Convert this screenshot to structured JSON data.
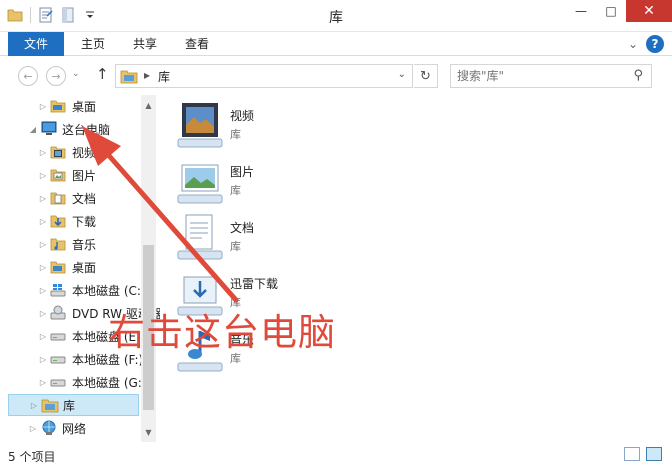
{
  "window": {
    "title": "库",
    "minimize_glyph": "—",
    "maximize_glyph": "□",
    "close_glyph": "✕"
  },
  "ribbon": {
    "tabs": [
      {
        "label": "文件"
      },
      {
        "label": "主页"
      },
      {
        "label": "共享"
      },
      {
        "label": "查看"
      }
    ],
    "collapse_glyph": "⌄",
    "help_glyph": "?"
  },
  "address": {
    "back_glyph": "←",
    "forward_glyph": "→",
    "recent_glyph": "⌄",
    "up_glyph": "↑",
    "separator_glyph": "▸",
    "crumb": "库",
    "dropdown_glyph": "⌄",
    "refresh_glyph": "↻"
  },
  "search": {
    "placeholder": "搜索\"库\"",
    "icon": "search-icon",
    "icon_glyph": "⚲"
  },
  "nav": {
    "items": [
      {
        "label": "桌面",
        "icon": "desktop-folder-icon",
        "expander": "▷"
      },
      {
        "label": "这台电脑",
        "icon": "computer-icon",
        "expander": "◢"
      },
      {
        "label": "视频",
        "icon": "video-folder-icon",
        "expander": "▷"
      },
      {
        "label": "图片",
        "icon": "pictures-folder-icon",
        "expander": "▷"
      },
      {
        "label": "文档",
        "icon": "documents-folder-icon",
        "expander": "▷"
      },
      {
        "label": "下载",
        "icon": "downloads-folder-icon",
        "expander": "▷"
      },
      {
        "label": "音乐",
        "icon": "music-folder-icon",
        "expander": "▷"
      },
      {
        "label": "桌面",
        "icon": "desktop-folder-icon",
        "expander": "▷"
      },
      {
        "label": "本地磁盘 (C:)",
        "icon": "windows-drive-icon",
        "expander": "▷"
      },
      {
        "label": "DVD RW 驱动器",
        "icon": "dvd-drive-icon",
        "expander": "▷"
      },
      {
        "label": "本地磁盘 (E:)",
        "icon": "drive-icon",
        "expander": "▷"
      },
      {
        "label": "本地磁盘 (F:)",
        "icon": "drive-icon",
        "expander": "▷"
      },
      {
        "label": "本地磁盘 (G:)",
        "icon": "drive-icon",
        "expander": "▷"
      },
      {
        "label": "库",
        "icon": "library-icon",
        "expander": "▷",
        "selected": true
      },
      {
        "label": "网络",
        "icon": "network-icon",
        "expander": "▷"
      }
    ],
    "scroll_up_glyph": "▲",
    "scroll_down_glyph": "▼"
  },
  "libraries": [
    {
      "name": "视频",
      "type": "库",
      "icon": "video-library-icon"
    },
    {
      "name": "图片",
      "type": "库",
      "icon": "pictures-library-icon"
    },
    {
      "name": "文档",
      "type": "库",
      "icon": "documents-library-icon"
    },
    {
      "name": "迅雷下载",
      "type": "库",
      "icon": "download-library-icon"
    },
    {
      "name": "音乐",
      "type": "库",
      "icon": "music-library-icon"
    }
  ],
  "status": {
    "count": "5 个项目"
  },
  "annotation": {
    "text": "右击这台电脑",
    "color": "#e04a3a"
  },
  "colors": {
    "accent": "#1e6fc1",
    "selection": "#cde8f6",
    "close": "#c7372f"
  }
}
